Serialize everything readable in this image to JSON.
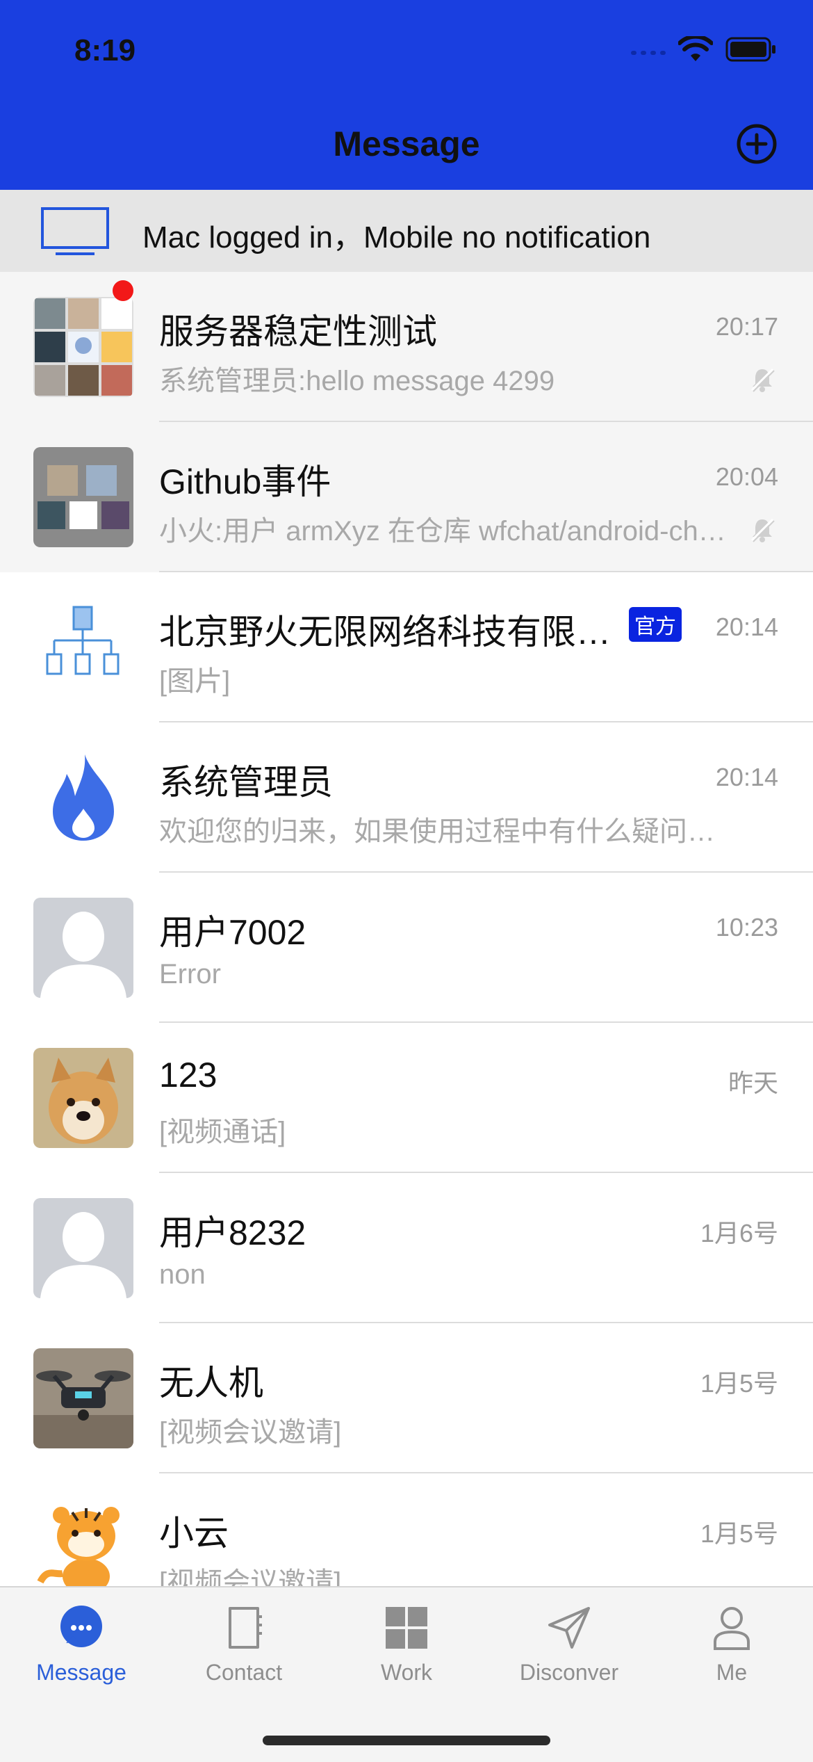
{
  "status": {
    "time": "8:19"
  },
  "nav": {
    "title": "Message"
  },
  "banner": {
    "text": "Mac logged in，Mobile no notification"
  },
  "colors": {
    "accent": "#1a3fe0",
    "tab_active": "#2b5fd9",
    "badge": "#f21818",
    "official": "#0a24e0"
  },
  "conversations": [
    {
      "title": "服务器稳定性测试",
      "time": "20:17",
      "preview": "系统管理员:hello message 4299",
      "pinned": true,
      "muted": true,
      "unread_dot": true,
      "avatar": "group-collage"
    },
    {
      "title": "Github事件",
      "time": "20:04",
      "preview": "小火:用户 armXyz 在仓库 wfchat/android-chat 中...",
      "pinned": true,
      "muted": true,
      "avatar": "group-collage-gray"
    },
    {
      "title": "北京野火无限网络科技有限公司",
      "time": "20:14",
      "preview": "[图片]",
      "official_badge": "官方",
      "avatar": "org-chart-icon"
    },
    {
      "title": "系统管理员",
      "time": "20:14",
      "preview": "欢迎您的归来，如果使用过程中有什么疑问可以联系我",
      "avatar": "flame-icon"
    },
    {
      "title": "用户7002",
      "time": "10:23",
      "preview": "Error",
      "avatar": "default-person"
    },
    {
      "title": "123",
      "time": "昨天",
      "preview": "[视频通话]",
      "avatar": "doge-photo"
    },
    {
      "title": "用户8232",
      "time": "1月6号",
      "preview": "non",
      "avatar": "default-person"
    },
    {
      "title": "无人机",
      "time": "1月5号",
      "preview": "[视频会议邀请]",
      "avatar": "drone-photo"
    },
    {
      "title": "小云",
      "time": "1月5号",
      "preview": "[视频会议邀请]",
      "avatar": "tiger-cartoon"
    }
  ],
  "tabs": [
    {
      "label": "Message",
      "icon": "chat-bubble-icon",
      "active": true
    },
    {
      "label": "Contact",
      "icon": "contact-book-icon"
    },
    {
      "label": "Work",
      "icon": "grid-icon"
    },
    {
      "label": "Disconver",
      "icon": "paper-plane-icon"
    },
    {
      "label": "Me",
      "icon": "person-icon"
    }
  ]
}
